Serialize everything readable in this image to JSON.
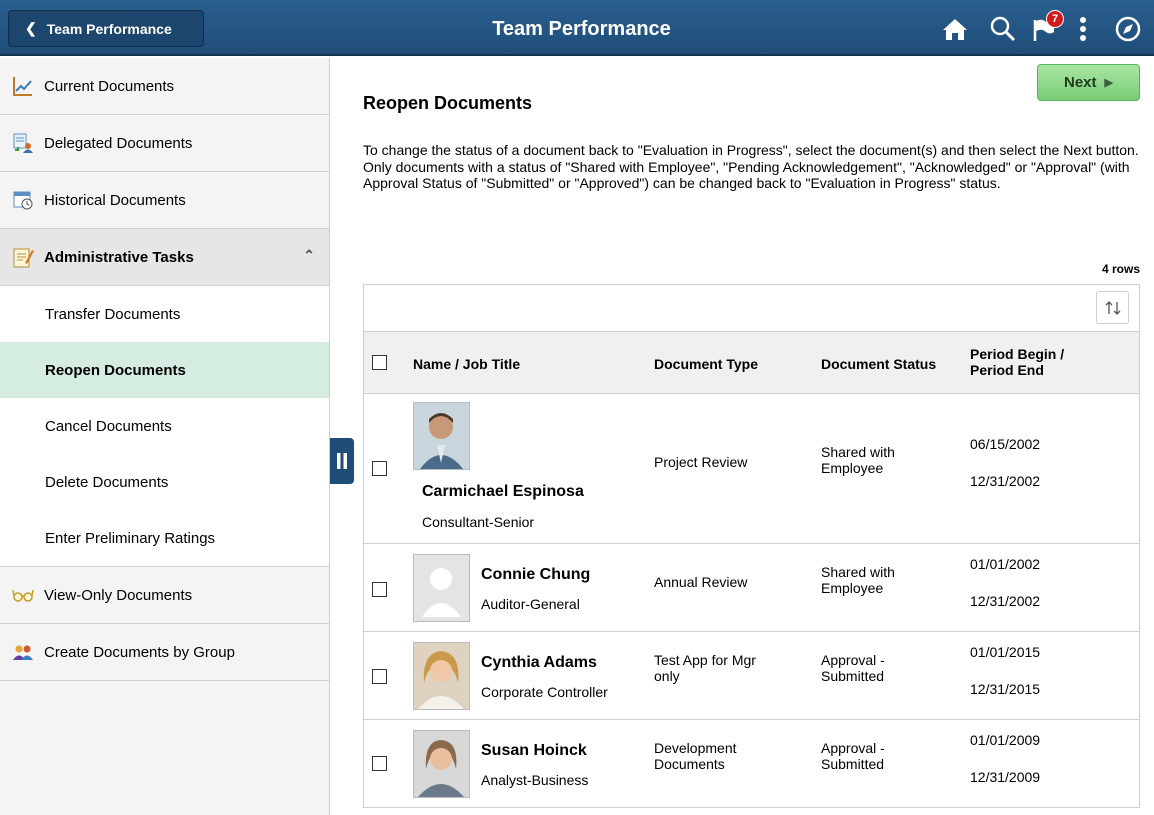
{
  "header": {
    "back_label": "Team Performance",
    "title": "Team Performance",
    "notifications_count": "7"
  },
  "sidebar": {
    "items": [
      {
        "label": "Current Documents",
        "icon": "chart-line-icon"
      },
      {
        "label": "Delegated Documents",
        "icon": "delegate-icon"
      },
      {
        "label": "Historical Documents",
        "icon": "calendar-clock-icon"
      }
    ],
    "group": {
      "label": "Administrative Tasks",
      "icon": "notepad-icon"
    },
    "sub_items": [
      {
        "label": "Transfer Documents"
      },
      {
        "label": "Reopen Documents"
      },
      {
        "label": "Cancel  Documents"
      },
      {
        "label": "Delete Documents"
      },
      {
        "label": "Enter Preliminary Ratings"
      }
    ],
    "bottom_items": [
      {
        "label": "View-Only Documents",
        "icon": "glasses-icon"
      },
      {
        "label": "Create Documents by Group",
        "icon": "group-icon"
      }
    ]
  },
  "main": {
    "next_label": "Next",
    "title": "Reopen Documents",
    "desc1": "To change the status of a document back to \"Evaluation in Progress\", select the document(s) and then select the Next button.",
    "desc2": "Only documents with a status of \"Shared with Employee\", \"Pending Acknowledgement\", \"Acknowledged\" or \"Approval\" (with Approval Status of \"Submitted\" or \"Approved\") can be changed back to \"Evaluation in Progress\" status.",
    "rows_count": "4 rows",
    "columns": {
      "name": "Name / Job Title",
      "type": "Document Type",
      "status": "Document Status",
      "period_line1": "Period Begin /",
      "period_line2": "Period End"
    },
    "rows": [
      {
        "name": "Carmichael Espinosa",
        "job": "Consultant-Senior",
        "type": "Project Review",
        "status1": "Shared with",
        "status2": "Employee",
        "begin": "06/15/2002",
        "end": "12/31/2002"
      },
      {
        "name": "Connie Chung",
        "job": "Auditor-General",
        "type": "Annual Review",
        "status1": "Shared with",
        "status2": "Employee",
        "begin": "01/01/2002",
        "end": "12/31/2002"
      },
      {
        "name": "Cynthia Adams",
        "job": "Corporate Controller",
        "type1": "Test App for Mgr",
        "type2": "only",
        "status1": "Approval -",
        "status2": "Submitted",
        "begin": "01/01/2015",
        "end": "12/31/2015"
      },
      {
        "name": "Susan Hoinck",
        "job": "Analyst-Business",
        "type1": "Development",
        "type2": "Documents",
        "status1": "Approval -",
        "status2": "Submitted",
        "begin": "01/01/2009",
        "end": "12/31/2009"
      }
    ]
  },
  "colors": {
    "header": "#1f4d78",
    "active_nav": "#d5ede0",
    "next_button": "#8fd98c",
    "badge": "#d21a1a"
  }
}
